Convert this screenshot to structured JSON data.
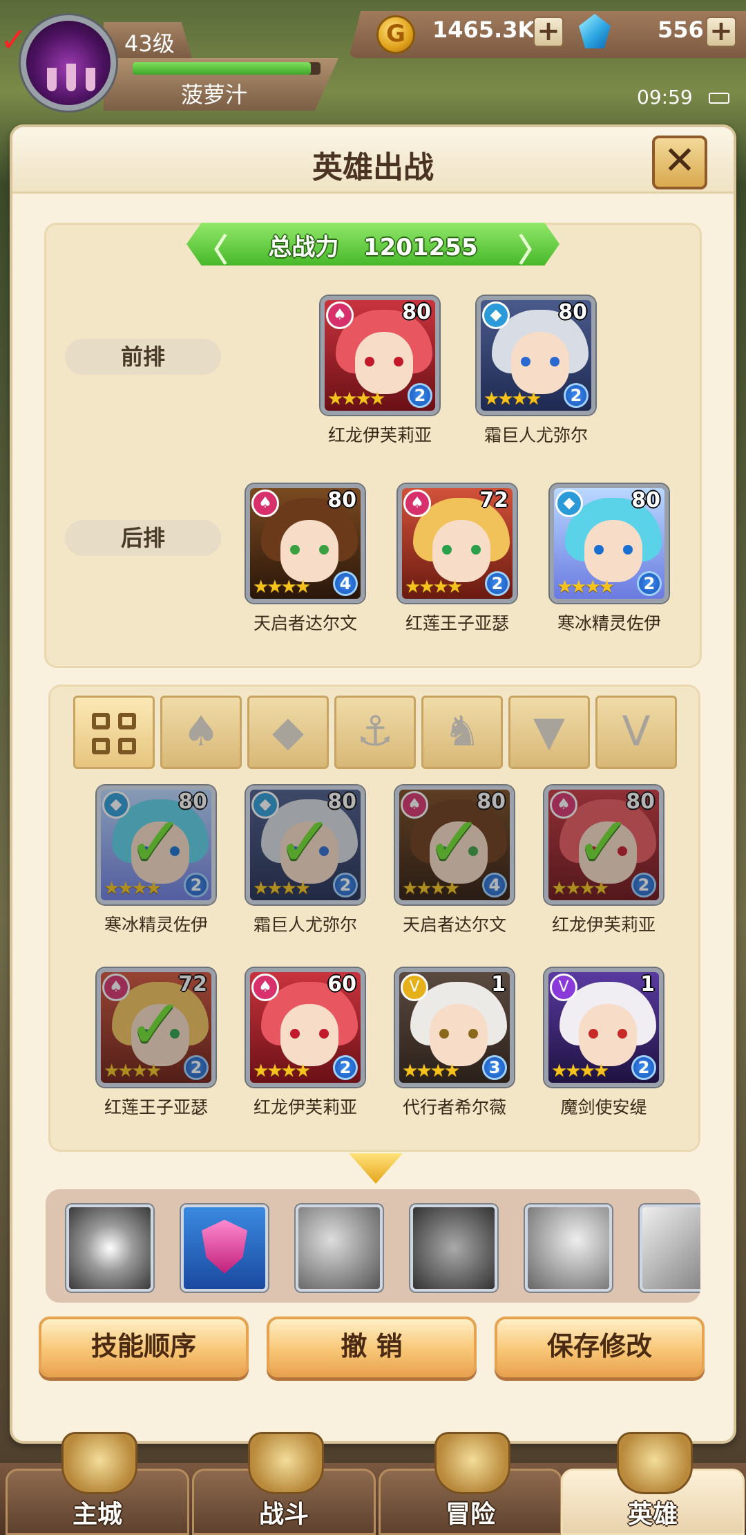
{
  "player": {
    "level": "43级",
    "name": "菠萝汁",
    "xp_fraction": 0.95
  },
  "resources": {
    "gold": "1465.3K",
    "gems": "556",
    "coin_symbol": "G",
    "plus": "+"
  },
  "status": {
    "time": "09:59"
  },
  "panel": {
    "title": "英雄出战",
    "close": "✕"
  },
  "power": {
    "label": "总战力",
    "value": "1201255",
    "left": "〈",
    "right": "〉"
  },
  "rows": {
    "front": "前排",
    "back": "后排"
  },
  "front_row": [
    {
      "name": "红龙伊芙莉亚",
      "level": "80",
      "rank": "2",
      "element": "fire",
      "theme": "red"
    },
    {
      "name": "霜巨人尤弥尔",
      "level": "80",
      "rank": "2",
      "element": "ice",
      "theme": "silver"
    }
  ],
  "back_row": [
    {
      "name": "天启者达尔文",
      "level": "80",
      "rank": "4",
      "element": "fire",
      "theme": "brown"
    },
    {
      "name": "红莲王子亚瑟",
      "level": "72",
      "rank": "2",
      "element": "fire",
      "theme": "blond"
    },
    {
      "name": "寒冰精灵佐伊",
      "level": "80",
      "rank": "2",
      "element": "ice",
      "theme": "cyan"
    }
  ],
  "filters": [
    "all-grid-icon",
    "fire-leaf-icon",
    "ice-diamond-icon",
    "anchor-icon",
    "beast-head-icon",
    "dark-horn-icon",
    "v-wing-icon"
  ],
  "roster": [
    {
      "name": "寒冰精灵佐伊",
      "level": "80",
      "rank": "2",
      "selected": true,
      "theme": "cyan"
    },
    {
      "name": "霜巨人尤弥尔",
      "level": "80",
      "rank": "2",
      "selected": true,
      "theme": "silver"
    },
    {
      "name": "天启者达尔文",
      "level": "80",
      "rank": "4",
      "selected": true,
      "theme": "brown"
    },
    {
      "name": "红龙伊芙莉亚",
      "level": "80",
      "rank": "2",
      "selected": true,
      "theme": "red"
    },
    {
      "name": "红莲王子亚瑟",
      "level": "72",
      "rank": "2",
      "selected": true,
      "theme": "blond"
    },
    {
      "name": "红龙伊芙莉亚",
      "level": "60",
      "rank": "2",
      "selected": false,
      "theme": "red"
    },
    {
      "name": "代行者希尔薇",
      "level": "1",
      "rank": "3",
      "selected": false,
      "theme": "white"
    },
    {
      "name": "魔剑使安缇",
      "level": "1",
      "rank": "2",
      "selected": false,
      "theme": "purple"
    }
  ],
  "skills": [
    "vortex-skill-icon",
    "fire-shield-skill-icon",
    "slash-skill-icon",
    "shield-skill-icon",
    "crystal-skill-icon",
    "shard-skill-icon"
  ],
  "buttons": {
    "order": "技能顺序",
    "undo": "撤 销",
    "save": "保存修改"
  },
  "nav": [
    "主城",
    "战斗",
    "冒险",
    "英雄"
  ],
  "colors": {
    "panel": "#f9f1de",
    "power_green": "#47b82a",
    "check": "#6fe02e",
    "button": "#f8c777"
  }
}
